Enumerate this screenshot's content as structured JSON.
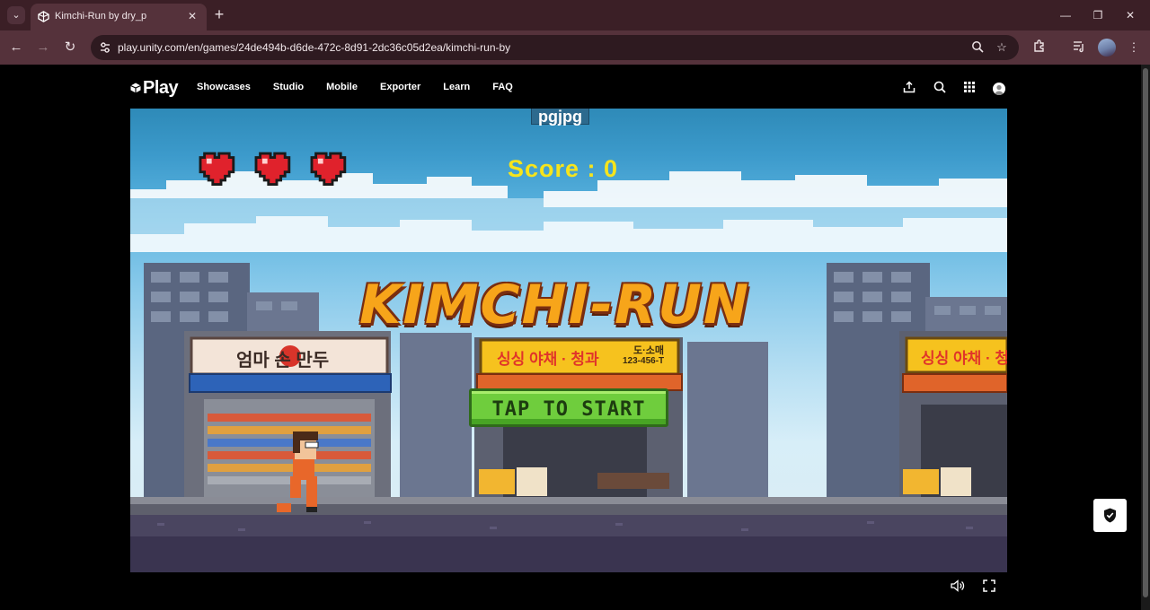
{
  "browser": {
    "tab_title": "Kimchi-Run by dry_p",
    "url": "play.unity.com/en/games/24de494b-d6de-472c-8d91-2dc36c05d2ea/kimchi-run-by"
  },
  "site": {
    "logo": "Play",
    "nav": [
      "Showcases",
      "Studio",
      "Mobile",
      "Exporter",
      "Learn",
      "FAQ"
    ]
  },
  "game": {
    "username": "pgjpg",
    "score_label": "Score : 0",
    "lives": 3,
    "title": "KIMCHI-RUN",
    "start_button": "TAP TO START",
    "shop_left_sign": "엄마 손 만두",
    "shop_middle_sign": "싱싱 야채 · 청과",
    "shop_middle_sub1": "도·소매",
    "shop_middle_sub2": "123-456-T",
    "shop_right_sign": "싱싱 야채 · 청",
    "heart_color": "#e0222c",
    "score_color": "#f6e41c",
    "button_color": "#6fcd3d"
  }
}
